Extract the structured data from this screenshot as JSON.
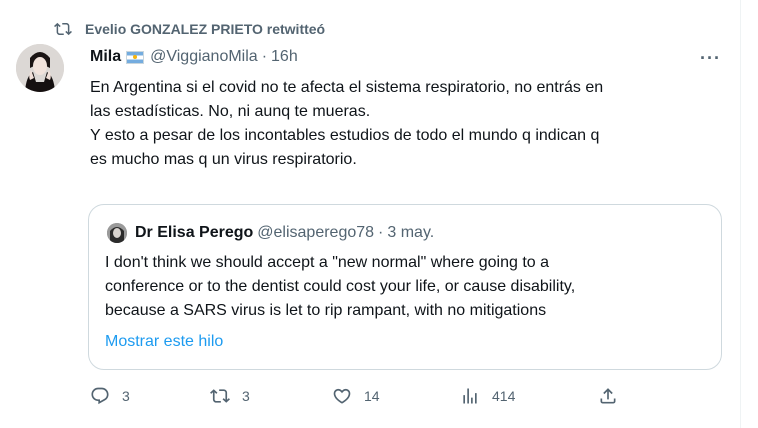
{
  "retweet": {
    "label": "Evelio GONZALEZ PRIETO retwitteó"
  },
  "tweet": {
    "author_name": "Mila",
    "author_handle": "@ViggianoMila",
    "separator": "·",
    "time": "16h",
    "more_label": "···",
    "lines": [
      "En Argentina si el covid no te afecta el sistema respiratorio, no entrás en",
      "las estadísticas. No, ni aunq te mueras.",
      "Y esto a pesar de los incontables estudios de todo el mundo q indican q",
      "es mucho mas q un virus respiratorio."
    ]
  },
  "quote": {
    "author_name": "Dr Elisa Perego",
    "author_handle": "@elisaperego78",
    "separator": "·",
    "time": "3 may.",
    "lines": [
      "I don't think we should accept a \"new normal\" where going to a",
      "conference or to the dentist could cost your life, or cause disability,",
      "because a SARS virus is let to rip rampant, with no mitigations"
    ],
    "show_thread": "Mostrar este hilo"
  },
  "actions": {
    "replies": "3",
    "retweets": "3",
    "likes": "14",
    "views": "414"
  },
  "colors": {
    "accent": "#1d9bf0",
    "muted": "#536471",
    "text": "#0f1419",
    "border": "#cfd9de"
  }
}
